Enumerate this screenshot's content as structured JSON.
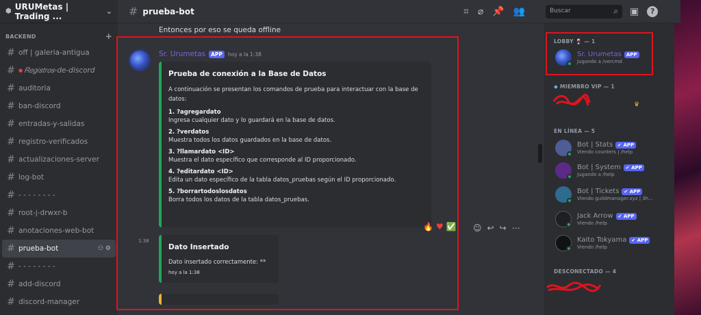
{
  "server": {
    "name": "URUMetas | Trading ..."
  },
  "sidebar": {
    "category": "BACKEND",
    "channels": [
      {
        "name": "off | galeria-antigua"
      },
      {
        "name": "𝑅𝑒𝑔𝑖𝑠𝑡𝑟𝑜𝑠-de-discord"
      },
      {
        "name": "auditoria"
      },
      {
        "name": "ban-discord"
      },
      {
        "name": "entradas-y-salidas"
      },
      {
        "name": "registro-verificados"
      },
      {
        "name": "actualizaciones-server"
      },
      {
        "name": "log-bot"
      },
      {
        "name": "- - - - - - - -"
      },
      {
        "name": "root-j-drwxr-b"
      },
      {
        "name": "anotaciones-web-bot"
      },
      {
        "name": "prueba-bot"
      },
      {
        "name": "- - - - - - - -"
      },
      {
        "name": "add-discord"
      },
      {
        "name": "discord-manager"
      }
    ]
  },
  "header": {
    "channel": "prueba-bot",
    "search_placeholder": "Buscar"
  },
  "messages": {
    "previous_line": "Entonces por eso se queda offline",
    "author": "Sr. Urumetas",
    "app_badge": "APP",
    "timestamp": "hoy a la 1:38",
    "embed": {
      "title": "Prueba de conexión a la Base de Datos",
      "description": "A continuación se presentan los comandos de prueba para interactuar con la base de datos:",
      "commands": [
        {
          "name": "1. ?agregardato",
          "desc": "Ingresa cualquier dato y lo guardará en la base de datos."
        },
        {
          "name": "2. ?verdatos",
          "desc": "Muestra todos los datos guardados en la base de datos."
        },
        {
          "name": "3. ?llamardato <ID>",
          "desc": "Muestra el dato específico que corresponde al ID proporcionado."
        },
        {
          "name": "4. ?editardato <ID>",
          "desc": "Edita un dato específico de la tabla datos_pruebas según el ID proporcionado."
        },
        {
          "name": "5. ?borrartodoslosdatos",
          "desc": "Borra todos los datos de la tabla datos_pruebas."
        }
      ]
    },
    "second": {
      "side_time": "1:38",
      "title": "Dato Insertado",
      "desc": "Dato insertado correctamente: **",
      "timestamp": "hoy a la 1:38"
    }
  },
  "members": {
    "lobby": {
      "header": "LOBBY 🍷 — 1",
      "name": "Sr. Urumetas",
      "badge": "APP",
      "activity": "Jugando a /vercmd"
    },
    "vip_header": "MIEMBRO VIP — 1",
    "online_header": "EN LÍNEA — 5",
    "online": [
      {
        "name": "Bot | Stats",
        "badge": "✔ APP",
        "activity": "Viendo counters | /help",
        "color": "#4e5d94"
      },
      {
        "name": "Bot | System",
        "badge": "✔ APP",
        "activity": "Jugando a /help",
        "color": "#5b2a86"
      },
      {
        "name": "Bot | Tickets",
        "badge": "✔ APP",
        "activity": "Viendo guildmanager.xyz | 3h...",
        "color": "#2f6b8f"
      },
      {
        "name": "Jack Arrow",
        "badge": "✔ APP",
        "activity": "Viendo /help",
        "color": "#1e1f22"
      },
      {
        "name": "Kaito Tokyama",
        "badge": "✔ APP",
        "activity": "Viendo /help",
        "color": "#111214"
      }
    ],
    "offline_header": "DESCONECTADO — 4"
  },
  "colors": {
    "accent": "#5865f2",
    "embed_border": "#23a55a",
    "highlight": "#e0141e",
    "author": "#7d64d8"
  }
}
